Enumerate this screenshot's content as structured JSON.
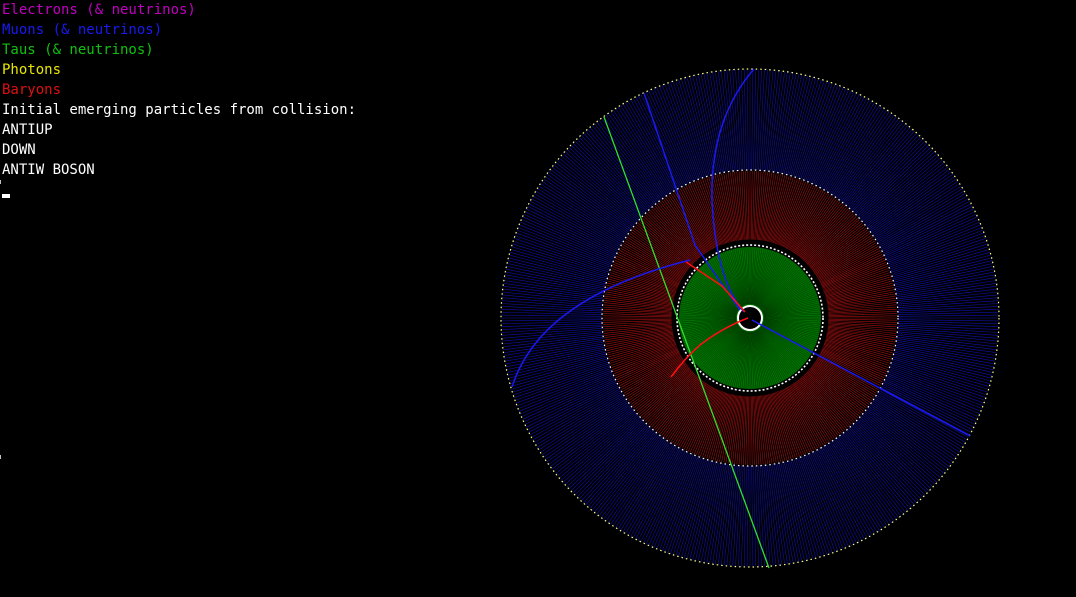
{
  "legend": {
    "electrons": {
      "label": "Electrons (& neutrinos)",
      "color": "#c000c0"
    },
    "muons": {
      "label": "Muons (& neutrinos)",
      "color": "#1a1af0"
    },
    "taus": {
      "label": "Taus (& neutrinos)",
      "color": "#10c010"
    },
    "photons": {
      "label": "Photons",
      "color": "#e8e800"
    },
    "baryons": {
      "label": "Baryons",
      "color": "#e01010"
    }
  },
  "output": {
    "heading": "Initial emerging particles from collision:",
    "particles": [
      "ANTIUP",
      "DOWN",
      "ANTIW BOSON"
    ],
    "text_color": "#ffffff"
  },
  "detector": {
    "regions": {
      "outer_color": "#1010a8",
      "middle_color": "#a01010",
      "inner_color": "#007000",
      "boundary_outer_color": "#ffff80",
      "boundary_inner_color": "#ffffff"
    },
    "tracks": {
      "muon_color": "#1a1af0",
      "tau_color": "#30e030",
      "baryon_color": "#ff1010"
    }
  }
}
